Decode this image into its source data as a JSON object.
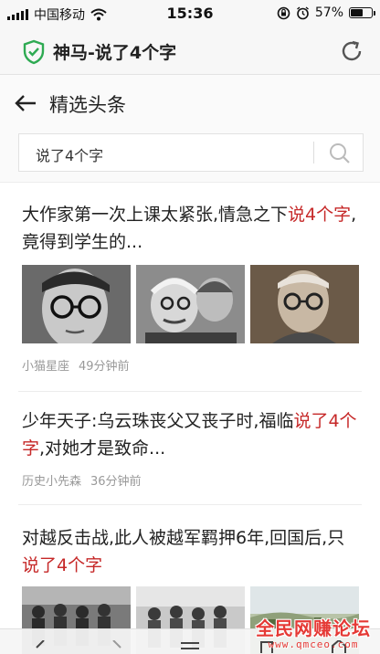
{
  "status_bar": {
    "carrier": "中国移动",
    "time": "15:36",
    "battery": "57%",
    "battery_level": 0.57
  },
  "browser": {
    "title": "神马-说了4个字"
  },
  "page": {
    "title": "精选头条"
  },
  "search": {
    "value": "说了4个字"
  },
  "articles": [
    {
      "title_before": "大作家第一次上课太紧张,情急之下",
      "title_highlight": "说4个字",
      "title_after": ",竟得到学生的...",
      "source": "小猫星座",
      "time": "49分钟前"
    },
    {
      "title_before": "少年天子:乌云珠丧父又丧子时,福临",
      "title_highlight": "说了4个字",
      "title_after": ",对她才是致命...",
      "source": "历史小先森",
      "time": "36分钟前"
    },
    {
      "title_before": "对越反击战,此人被越军羁押6年,回国后,只",
      "title_highlight": "说了4个字",
      "title_after": ""
    }
  ],
  "watermark": {
    "main": "全民网赚论坛",
    "sub": "www.qmceo.com"
  },
  "colors": {
    "highlight": "#c62828",
    "shield": "#2eaa52",
    "watermark": "#e53935"
  }
}
